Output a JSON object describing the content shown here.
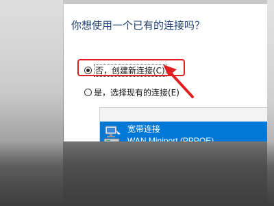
{
  "dialog": {
    "heading": "你想使用一个已有的连接吗？",
    "options": [
      {
        "label": "否，创建新连接(C)",
        "selected": true
      },
      {
        "label": "是，选择现有的连接(E)",
        "selected": false
      }
    ],
    "connection_list": [
      {
        "name": "宽带连接",
        "device": "WAN Miniport (PPPOE)",
        "icon": "network-connection-icon",
        "selected": true
      }
    ]
  },
  "colors": {
    "heading": "#1e3f6e",
    "selection": "#0078d7",
    "annotation": "#e02020"
  }
}
